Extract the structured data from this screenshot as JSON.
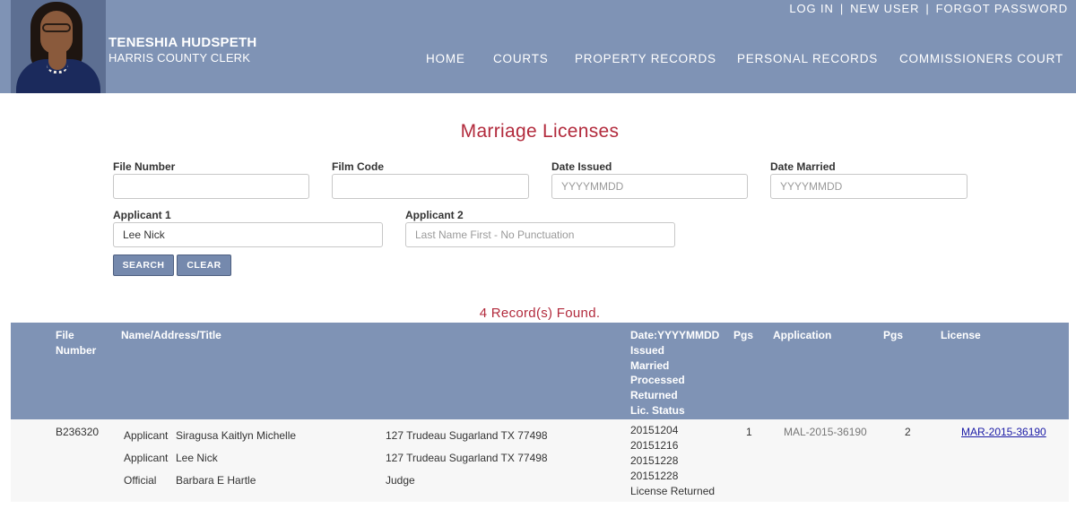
{
  "header": {
    "clerk_name": "TENESHIA HUDSPETH",
    "clerk_title": "HARRIS COUNTY CLERK",
    "top_links": [
      "LOG IN",
      "NEW USER",
      "FORGOT PASSWORD"
    ],
    "separator": "|",
    "nav": [
      "HOME",
      "COURTS",
      "PROPERTY RECORDS",
      "PERSONAL RECORDS",
      "COMMISSIONERS COURT"
    ]
  },
  "page": {
    "title": "Marriage Licenses"
  },
  "form": {
    "file_number": {
      "label": "File Number",
      "value": "",
      "placeholder": ""
    },
    "film_code": {
      "label": "Film Code",
      "value": "",
      "placeholder": ""
    },
    "date_issued": {
      "label": "Date Issued",
      "value": "",
      "placeholder": "YYYYMMDD"
    },
    "date_married": {
      "label": "Date Married",
      "value": "",
      "placeholder": "YYYYMMDD"
    },
    "applicant1": {
      "label": "Applicant 1",
      "value": "Lee Nick",
      "placeholder": ""
    },
    "applicant2": {
      "label": "Applicant 2",
      "value": "",
      "placeholder": "Last Name First - No Punctuation"
    },
    "search_label": "SEARCH",
    "clear_label": "CLEAR"
  },
  "results": {
    "summary": "4 Record(s) Found.",
    "columns": {
      "file_number": [
        "File",
        "Number"
      ],
      "name": "Name/Address/Title",
      "date": [
        "Date:YYYYMMDD",
        "Issued",
        "Married",
        "Processed",
        "Returned",
        "Lic. Status"
      ],
      "pgs1": "Pgs",
      "application": "Application",
      "pgs2": "Pgs",
      "license": "License"
    },
    "rows": [
      {
        "file_number": "B236320",
        "parties": [
          {
            "role": "Applicant",
            "name": "Siragusa Kaitlyn Michelle",
            "address": "127 Trudeau Sugarland TX 77498"
          },
          {
            "role": "Applicant",
            "name": "Lee Nick",
            "address": "127 Trudeau Sugarland TX 77498"
          },
          {
            "role": "Official",
            "name": "Barbara E Hartle",
            "address": "Judge"
          }
        ],
        "dates": [
          "20151204",
          "20151216",
          "20151228",
          "20151228",
          "License Returned"
        ],
        "pgs1": "1",
        "application": "MAL-2015-36190",
        "pgs2": "2",
        "license": "MAR-2015-36190"
      }
    ]
  }
}
